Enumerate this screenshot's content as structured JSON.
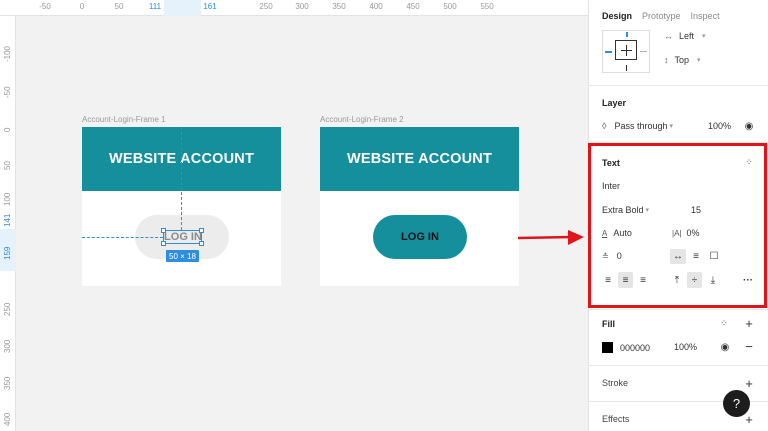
{
  "ruler": {
    "top_ticks": [
      "-50",
      "0",
      "50",
      "111",
      "161",
      "250",
      "300",
      "350",
      "400",
      "450",
      "500",
      "550"
    ],
    "left_ticks": [
      "-100",
      "-50",
      "0",
      "50",
      "100",
      "141",
      "159",
      "250",
      "300",
      "350",
      "400"
    ]
  },
  "canvas": {
    "frame1": {
      "label": "Account-Login-Frame 1",
      "header_text": "WEBSITE ACCOUNT",
      "button_text": "LOG IN",
      "selection_size": "50 × 18"
    },
    "frame2": {
      "label": "Account-Login-Frame 2",
      "header_text": "WEBSITE ACCOUNT",
      "button_text": "LOG IN"
    }
  },
  "panel": {
    "tabs": [
      "Design",
      "Prototype",
      "Inspect"
    ],
    "constraints": {
      "horizontal": "Left",
      "vertical": "Top"
    },
    "layer": {
      "title": "Layer",
      "blend_mode": "Pass through",
      "opacity": "100%"
    },
    "text": {
      "title": "Text",
      "font_family": "Inter",
      "font_weight": "Extra Bold",
      "font_size": "15",
      "line_height": "Auto",
      "letter_spacing": "0%",
      "paragraph_spacing": "0"
    },
    "fill": {
      "title": "Fill",
      "color": "000000",
      "opacity": "100%"
    },
    "stroke": {
      "title": "Stroke"
    },
    "effects": {
      "title": "Effects"
    },
    "help_label": "?"
  },
  "colors": {
    "accent": "#148f9b",
    "selection": "#2d8ee0",
    "highlight": "#e0141a"
  }
}
